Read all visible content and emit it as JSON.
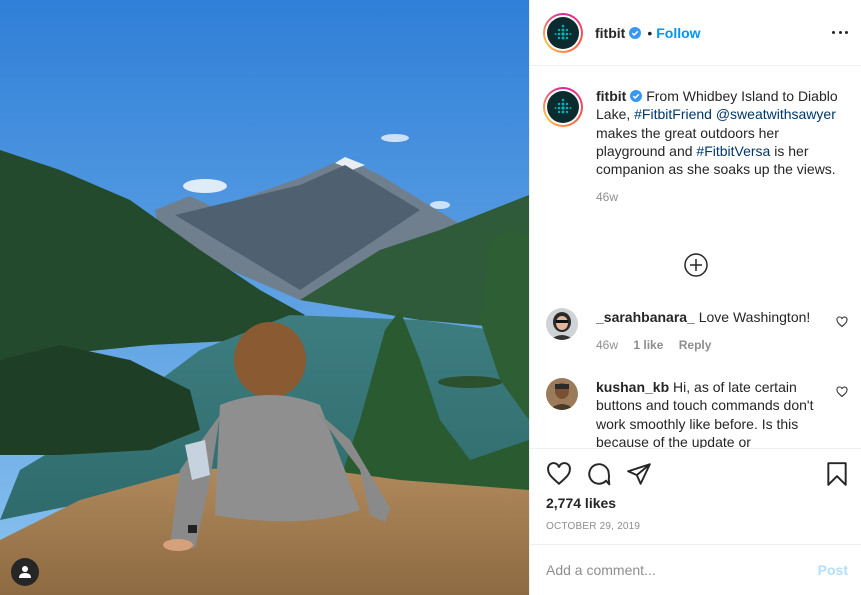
{
  "post": {
    "username": "fitbit",
    "follow_label": "Follow",
    "dot": "•"
  },
  "caption": {
    "username": "fitbit",
    "text_1": " From Whidbey Island to Diablo Lake, ",
    "hashtag_1": "#FitbitFriend",
    "mention": "@sweatwithsawyer",
    "text_2": " makes the great outdoors her playground and ",
    "hashtag_2": "#FitbitVersa",
    "text_3": " is her companion as she soaks up the views.",
    "time": "46w"
  },
  "comments": [
    {
      "username": "_sarahbanara_",
      "text": " Love Washington!",
      "time": "46w",
      "likes": "1 like",
      "reply": "Reply"
    },
    {
      "username": "kushan_kb",
      "text": " Hi, as of late certain buttons and touch commands don't work smoothly like before. Is this because of the update or"
    }
  ],
  "actions": {
    "likes": "2,774 likes",
    "date": "OCTOBER 29, 2019"
  },
  "add_comment": {
    "placeholder": "Add a comment...",
    "post_label": "Post"
  },
  "icons": {
    "more": "more-options-icon",
    "verified": "verified-badge-icon",
    "load_more": "plus-circle-icon",
    "like": "heart-icon",
    "comment": "comment-bubble-icon",
    "share": "paper-plane-icon",
    "save": "bookmark-icon",
    "user_tag": "user-tag-icon"
  },
  "colors": {
    "accent": "#0095f6",
    "hashtag": "#00376b",
    "muted": "#8e8e8e",
    "post_disabled": "#b2dffc"
  }
}
